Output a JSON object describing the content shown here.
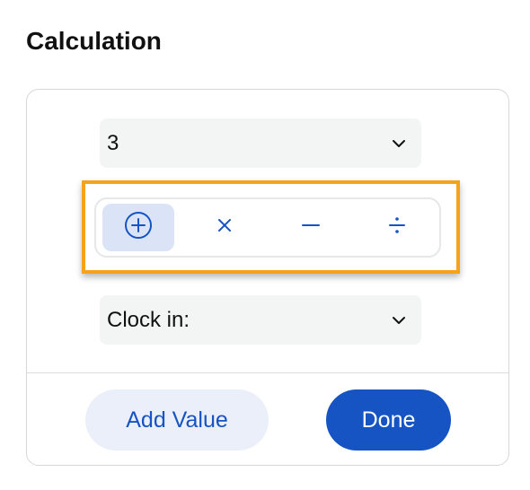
{
  "panel": {
    "title": "Calculation"
  },
  "first_select": {
    "value": "3",
    "icon": "chevron-down-icon"
  },
  "operators": [
    {
      "name": "add",
      "icon": "plus-circle-icon",
      "selected": true
    },
    {
      "name": "multiply",
      "icon": "multiply-icon",
      "selected": false
    },
    {
      "name": "subtract",
      "icon": "minus-icon",
      "selected": false
    },
    {
      "name": "divide",
      "icon": "divide-icon",
      "selected": false
    }
  ],
  "second_select": {
    "value": "Clock in:",
    "icon": "chevron-down-icon"
  },
  "actions": {
    "add_value_label": "Add Value",
    "done_label": "Done"
  },
  "colors": {
    "accent": "#1554c2",
    "selected_operator_bg": "#dbe4f7",
    "secondary_button_bg": "#eaeff9",
    "highlight_border": "#f7a21b",
    "select_bg": "#f3f4f4",
    "border": "#d6d8d8"
  }
}
